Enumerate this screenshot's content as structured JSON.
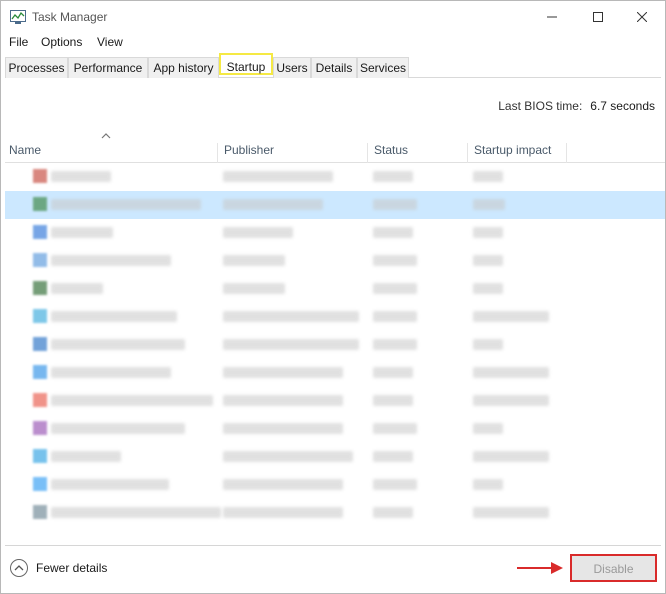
{
  "window": {
    "title": "Task Manager",
    "icon": "task-manager-icon"
  },
  "menu": {
    "items": [
      "File",
      "Options",
      "View"
    ]
  },
  "tabs": {
    "items": [
      "Processes",
      "Performance",
      "App history",
      "Startup",
      "Users",
      "Details",
      "Services"
    ],
    "active": "Startup",
    "highlight_color": "#f5e944"
  },
  "bios": {
    "label": "Last BIOS time:",
    "value": "6.7 seconds"
  },
  "columns": [
    "Name",
    "Publisher",
    "Status",
    "Startup impact"
  ],
  "rows": [
    {
      "icon_color": "#c0392b",
      "selected": false
    },
    {
      "icon_color": "#2e7d32",
      "selected": true
    },
    {
      "icon_color": "#1e6bd6",
      "selected": false
    },
    {
      "icon_color": "#4a90d9",
      "selected": false
    },
    {
      "icon_color": "#1b5e20",
      "selected": false
    },
    {
      "icon_color": "#29a3d9",
      "selected": false
    },
    {
      "icon_color": "#1565c0",
      "selected": false
    },
    {
      "icon_color": "#1e88e5",
      "selected": false
    },
    {
      "icon_color": "#e74c3c",
      "selected": false
    },
    {
      "icon_color": "#8e44ad",
      "selected": false
    },
    {
      "icon_color": "#1e9be0",
      "selected": false
    },
    {
      "icon_color": "#2196f3",
      "selected": false
    },
    {
      "icon_color": "#607d8b",
      "selected": false
    }
  ],
  "footer": {
    "fewer_details_label": "Fewer details",
    "disable_label": "Disable",
    "callout_color": "#d92b2b"
  }
}
